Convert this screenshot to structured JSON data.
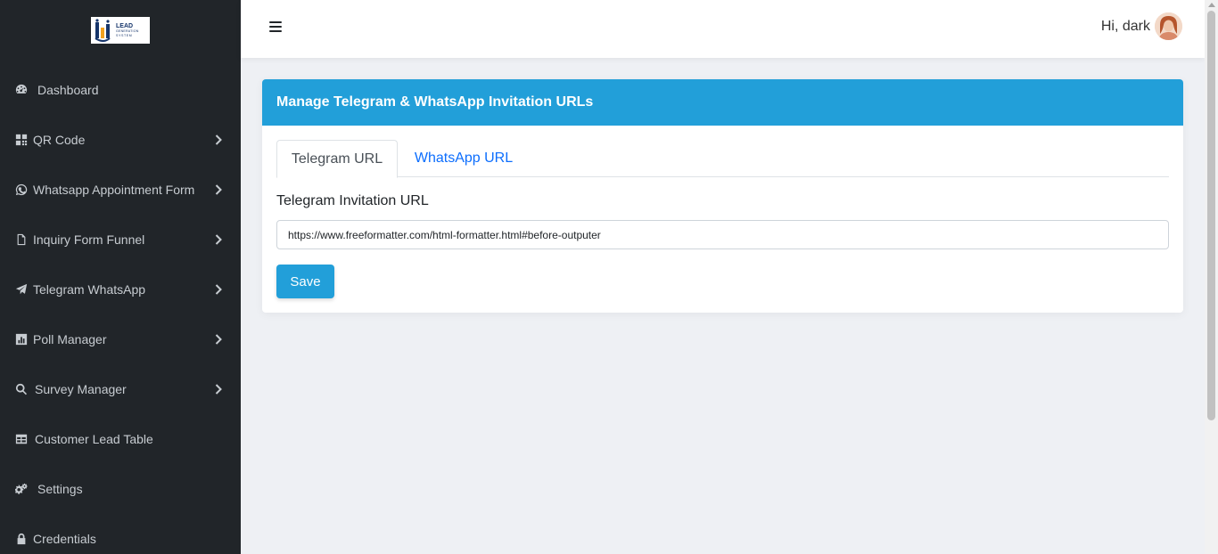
{
  "brand": {
    "logo_line1": "LEAD",
    "logo_line2": "GENERATION",
    "logo_line3": "SYSTEM"
  },
  "sidebar": {
    "items": [
      {
        "label": "Dashboard",
        "icon": "gauge-icon",
        "has_submenu": false
      },
      {
        "label": "QR Code",
        "icon": "qrcode-icon",
        "has_submenu": true
      },
      {
        "label": "Whatsapp Appointment Form",
        "icon": "whatsapp-icon",
        "has_submenu": true
      },
      {
        "label": "Inquiry Form Funnel",
        "icon": "file-icon",
        "has_submenu": true
      },
      {
        "label": "Telegram WhatsApp",
        "icon": "paper-plane-icon",
        "has_submenu": true
      },
      {
        "label": "Poll Manager",
        "icon": "bar-chart-icon",
        "has_submenu": true
      },
      {
        "label": "Survey Manager",
        "icon": "search-icon",
        "has_submenu": true
      },
      {
        "label": "Customer Lead Table",
        "icon": "table-icon",
        "has_submenu": false
      },
      {
        "label": "Settings",
        "icon": "gears-icon",
        "has_submenu": false
      },
      {
        "label": "Credentials",
        "icon": "lock-icon",
        "has_submenu": false
      }
    ]
  },
  "header": {
    "greeting": "Hi, dark",
    "menu_icon": "hamburger-icon"
  },
  "card": {
    "title": "Manage Telegram & WhatsApp Invitation URLs",
    "tabs": [
      {
        "label": "Telegram URL",
        "active": true
      },
      {
        "label": "WhatsApp URL",
        "active": false
      }
    ],
    "field_label": "Telegram Invitation URL",
    "url_value": "https://www.freeformatter.com/html-formatter.html#before-outputer",
    "save_label": "Save"
  },
  "colors": {
    "sidebar_bg": "#212529",
    "accent": "#229fd9",
    "link": "#0d6efd",
    "page_bg": "#eef0f4"
  }
}
